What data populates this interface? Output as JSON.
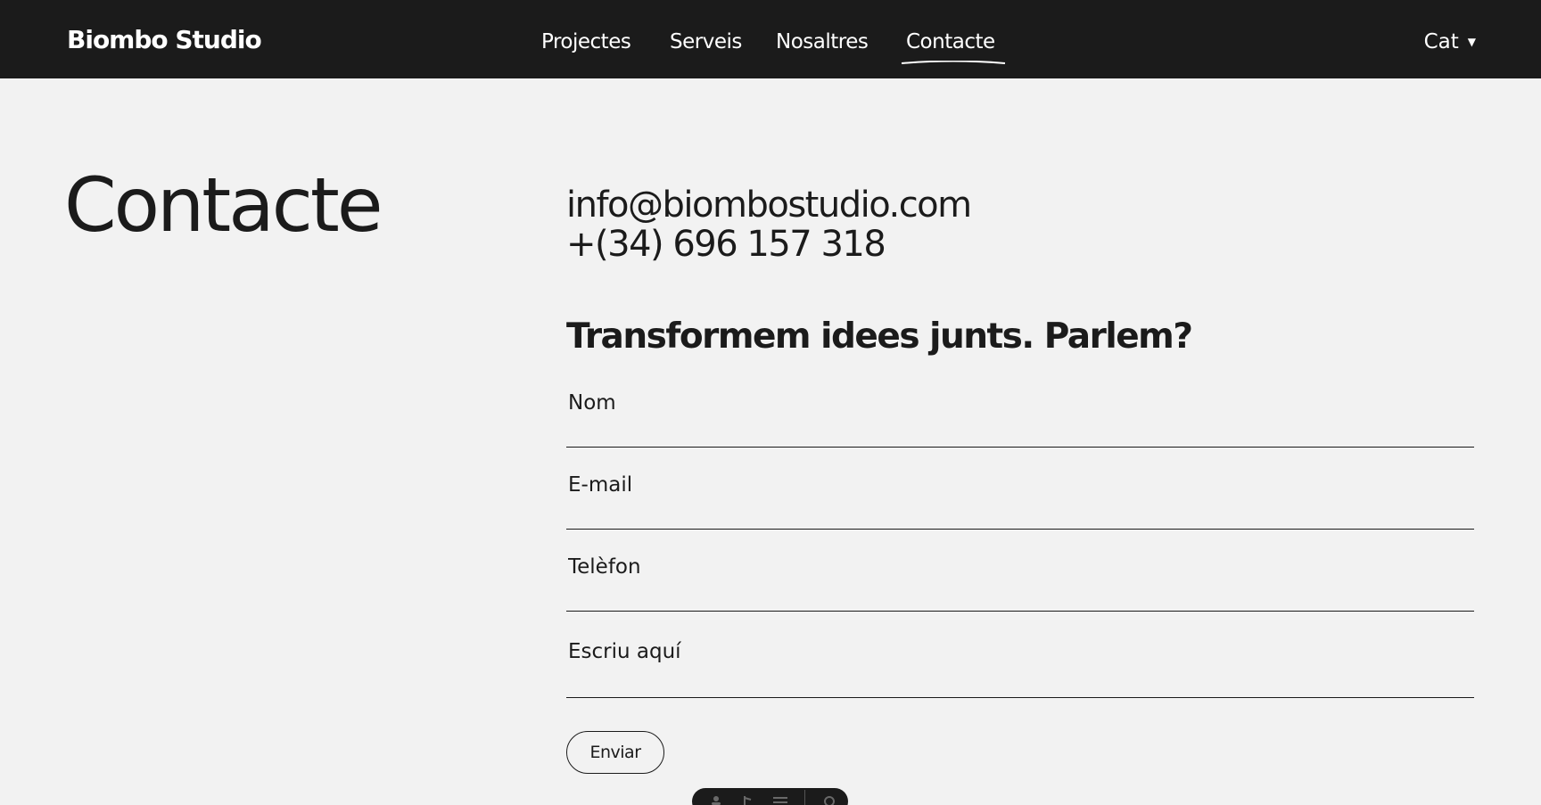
{
  "header": {
    "logo": "Biombo Studio",
    "nav": [
      {
        "label": "Projectes"
      },
      {
        "label": "Serveis"
      },
      {
        "label": "Nosaltres"
      },
      {
        "label": "Contacte",
        "active": true
      }
    ],
    "language": "Cat",
    "caret_icon": "caret-down-icon"
  },
  "main": {
    "title": "Contacte",
    "email": "info@biombostudio.com",
    "phone": "+(34) 696 157 318",
    "tagline": "Transformem idees junts. Parlem?",
    "form": {
      "name_placeholder": "Nom",
      "email_placeholder": "E-mail",
      "phone_placeholder": "Telèfon",
      "message_placeholder": "Escriu aquí",
      "submit_label": "Enviar"
    }
  },
  "toolbar": {
    "icons": [
      "person-icon",
      "pointer-icon",
      "menu-icon",
      "settings-icon"
    ]
  },
  "colors": {
    "header_bg": "#1b1b1b",
    "page_bg": "#f2f2f2",
    "text": "#1b1b1b",
    "header_text": "#ffffff"
  }
}
